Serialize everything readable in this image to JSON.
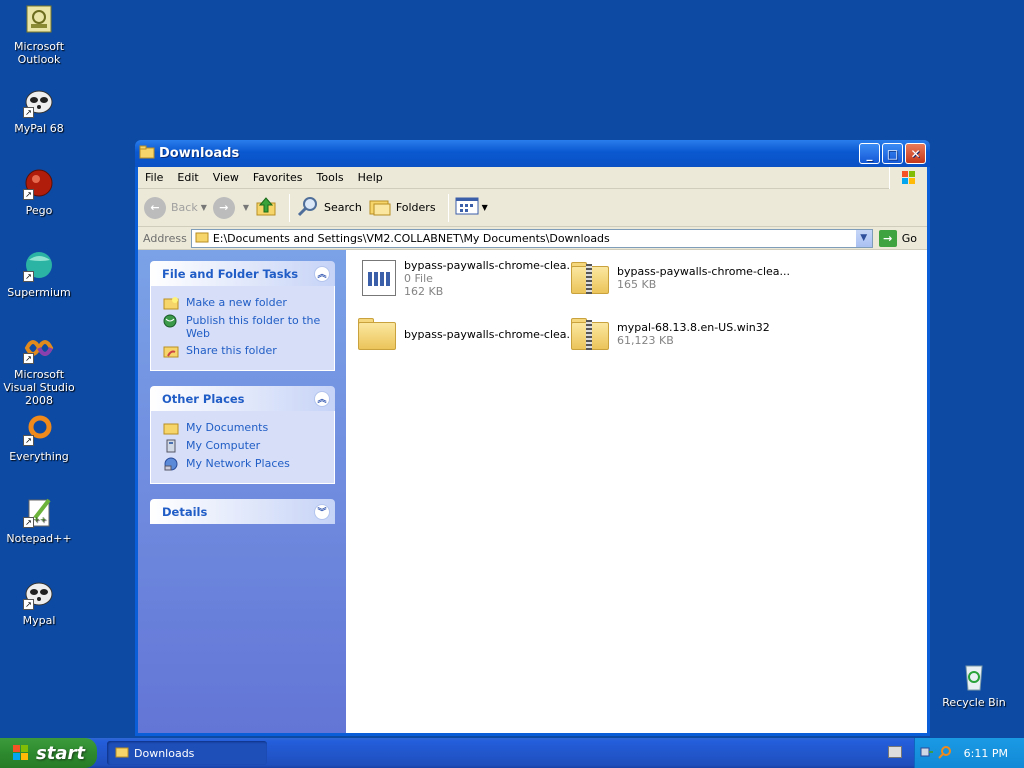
{
  "desktop": {
    "icons": [
      {
        "label": "Microsoft Outlook",
        "icon": "outlook-icon"
      },
      {
        "label": "MyPal 68",
        "icon": "mypal-icon"
      },
      {
        "label": "Pego",
        "icon": "pego-icon"
      },
      {
        "label": "Supermium",
        "icon": "supermium-icon"
      },
      {
        "label": "Microsoft Visual Studio 2008",
        "icon": "visual-studio-icon"
      },
      {
        "label": "Everything",
        "icon": "everything-icon"
      },
      {
        "label": "Notepad++",
        "icon": "notepadpp-icon"
      },
      {
        "label": "Mypal",
        "icon": "mypal-icon"
      },
      {
        "label": "Recycle Bin",
        "icon": "recycle-bin-icon"
      }
    ]
  },
  "window": {
    "title": "Downloads",
    "controls": {
      "minimize": "minimize-icon",
      "maximize": "maximize-icon",
      "close": "close-icon"
    },
    "menu": [
      "File",
      "Edit",
      "View",
      "Favorites",
      "Tools",
      "Help"
    ],
    "toolbar": {
      "back": "Back",
      "search": "Search",
      "folders": "Folders"
    },
    "address": {
      "label": "Address",
      "path": "E:\\Documents and Settings\\VM2.COLLABNET\\My Documents\\Downloads",
      "go": "Go"
    },
    "tasks": {
      "file_folder": {
        "title": "File and Folder Tasks",
        "items": [
          "Make a new folder",
          "Publish this folder to the Web",
          "Share this folder"
        ]
      },
      "other_places": {
        "title": "Other Places",
        "items": [
          "My Documents",
          "My Computer",
          "My Network Places"
        ]
      },
      "details": {
        "title": "Details"
      }
    },
    "files": [
      {
        "name": "bypass-paywalls-chrome-clea...",
        "line2": "0 File",
        "line3": "162 KB",
        "type": "document"
      },
      {
        "name": "bypass-paywalls-chrome-clea...",
        "line2": "165 KB",
        "type": "zip"
      },
      {
        "name": "bypass-paywalls-chrome-clea...",
        "type": "folder"
      },
      {
        "name": "mypal-68.13.8.en-US.win32",
        "line2": "61,123 KB",
        "type": "zip"
      }
    ]
  },
  "taskbar": {
    "start": "start",
    "task": "Downloads",
    "clock": "6:11 PM"
  }
}
